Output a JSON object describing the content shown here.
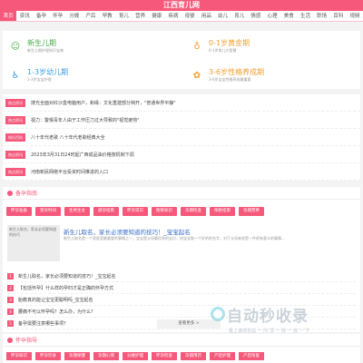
{
  "header": {
    "title": "江西育儿网"
  },
  "nav": [
    "首页",
    "资讯",
    "备孕",
    "怀孕",
    "分娩",
    "产后",
    "早教",
    "育儿",
    "营养",
    "健康",
    "疾病",
    "母婴",
    "用品",
    "幼儿",
    "育儿",
    "情感",
    "心理",
    "美食",
    "生活",
    "职场",
    "百科",
    "视频"
  ],
  "cards": [
    {
      "title": "新生儿期",
      "subtitle": "新生儿期护理知识宝典",
      "icon": "baby-icon"
    },
    {
      "title": "0-1岁黄金期",
      "subtitle": "0-1岁育儿大智慧",
      "icon": "bottle-icon"
    },
    {
      "title": "1-3岁幼儿期",
      "subtitle": "1-3岁宝宝护理",
      "icon": "walker-icon"
    },
    {
      "title": "3-6岁性格养成期",
      "subtitle": "3-6岁宝宝性格养成最重要",
      "icon": "child-icon"
    }
  ],
  "news": [
    {
      "tag": "热点资讯",
      "text": "搜光全面对红沙盒电脑用户，和缘：文化重建部分档开，\"普通世界平静\""
    },
    {
      "tag": "热点资讯",
      "text": "视力：警惕青年人由于工作压力过大导致的\"视觉疲劳\""
    },
    {
      "tag": "知识百科",
      "text": "八十年代老歌 八十年代老歌经典大全"
    },
    {
      "tag": "热点资讯",
      "text": "2023年3月31日24时起广西成品油价格按机制下调"
    },
    {
      "tag": "热点资讯",
      "text": "河南新民网络平台投资时间推进的入口"
    }
  ],
  "section1": {
    "title": "备孕指南",
    "chips": [
      "怀孕准备",
      "受孕时间",
      "生男生女",
      "避孕指南",
      "怀孕常识",
      "胎教知识",
      "孕期检查",
      "保胎指南",
      "孕期营养"
    ],
    "featured": {
      "thumb_text": "新生儿取名，家长必须要知道的技巧",
      "title": "新生儿取名，家长必须要知道的技巧！_宝宝起名",
      "desc": "新生儿取名是一个家庭里最重要的事情之一，宝宝是父母最珍贵的宝贝，给宝宝取一个好听的名字，对于父母来说是一件很有意义的事情..."
    },
    "list": [
      "新生儿取名，家长必须要知道的技巧！_宝宝起名",
      "【包括怀孕】什么样的孕妇才是正确的怀孕方式",
      "胎教真的能让宝宝更聪明吗_宝宝起名",
      "腰痛不可以怀孕吗？怎么办，为什么？",
      "备孕需要注意哪些事项？"
    ],
    "more": "查看更多 >"
  },
  "watermark": {
    "main": "自动秒收录",
    "sub": "极上速成名站 一 内 顶 一 快 一 收 一 下"
  },
  "section2": {
    "title": "怀孕指导",
    "chips": [
      "怀孕知识",
      "怀孕饮食",
      "孕期保健",
      "孕期心情",
      "分娩护理",
      "怀孕检查",
      "孕期用药",
      "产后护理",
      "产后恢复"
    ]
  }
}
